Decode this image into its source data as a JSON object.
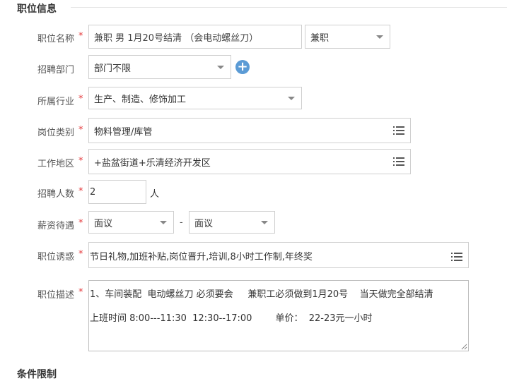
{
  "section": {
    "title": "职位信息",
    "next_title": "条件限制"
  },
  "form": {
    "job_name": {
      "label": "职位名称",
      "value": "兼职 男 1月20号结清 （会电动螺丝刀）",
      "type_value": "兼职"
    },
    "department": {
      "label": "招聘部门",
      "value": "部门不限"
    },
    "industry": {
      "label": "所属行业",
      "value": "生产、制造、修饰加工"
    },
    "category": {
      "label": "岗位类别",
      "value": "物料管理/库管"
    },
    "location": {
      "label": "工作地区",
      "value": "+盐盆街道+乐清经济开发区"
    },
    "headcount": {
      "label": "招聘人数",
      "value": "2",
      "unit": "人"
    },
    "salary": {
      "label": "薪资待遇",
      "min_value": "面议",
      "separator": "-",
      "max_value": "面议"
    },
    "benefits": {
      "label": "职位诱惑",
      "value": "节日礼物,加班补贴,岗位晋升,培训,8小时工作制,年终奖"
    },
    "description": {
      "label": "职位描述",
      "line1": "1、车间装配  电动螺丝刀 必须要会     兼职工必须做到1月20号    当天做完全部结清",
      "line2": "上班时间 8:00---11:30  12:30--17:00        单价：  22-23元一小时"
    },
    "required_mark": "*"
  },
  "icons": {
    "dropdown": "chevron-down-icon",
    "list": "list-icon",
    "add": "plus-circle-icon"
  },
  "colors": {
    "required": "#e4393c",
    "add_button": "#5b9bd5",
    "border": "#cfcfcf"
  }
}
